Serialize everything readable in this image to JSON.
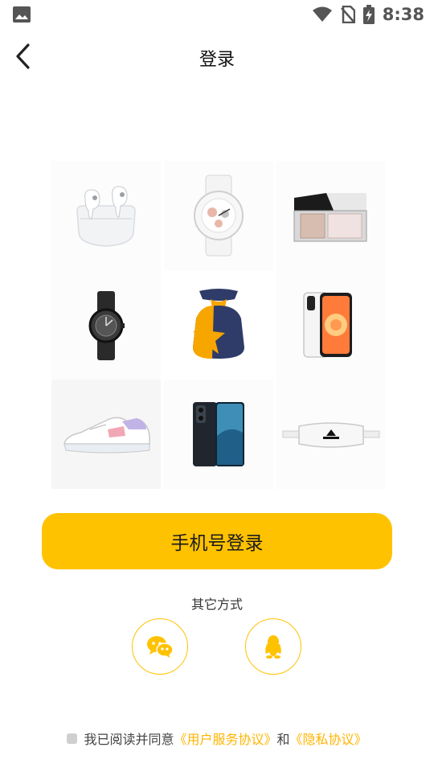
{
  "status_bar": {
    "time": "8:38"
  },
  "header": {
    "title": "登录"
  },
  "products": [
    {
      "name": "earbuds-product"
    },
    {
      "name": "watch-white-product"
    },
    {
      "name": "compact-product"
    },
    {
      "name": "watch-black-product"
    },
    {
      "name": "lucky-bag-product"
    },
    {
      "name": "iphone-product"
    },
    {
      "name": "sneaker-product"
    },
    {
      "name": "phone-blue-product"
    },
    {
      "name": "waist-bag-product"
    }
  ],
  "login": {
    "phone_button": "手机号登录",
    "other_methods": "其它方式",
    "icons": [
      "wechat-icon",
      "qq-icon"
    ]
  },
  "agreement": {
    "prefix": "我已阅读并同意",
    "user_agreement": "《用户服务协议》",
    "and": "和",
    "privacy": "《隐私协议》"
  },
  "colors": {
    "accent": "#ffc200",
    "link": "#ffb400"
  }
}
